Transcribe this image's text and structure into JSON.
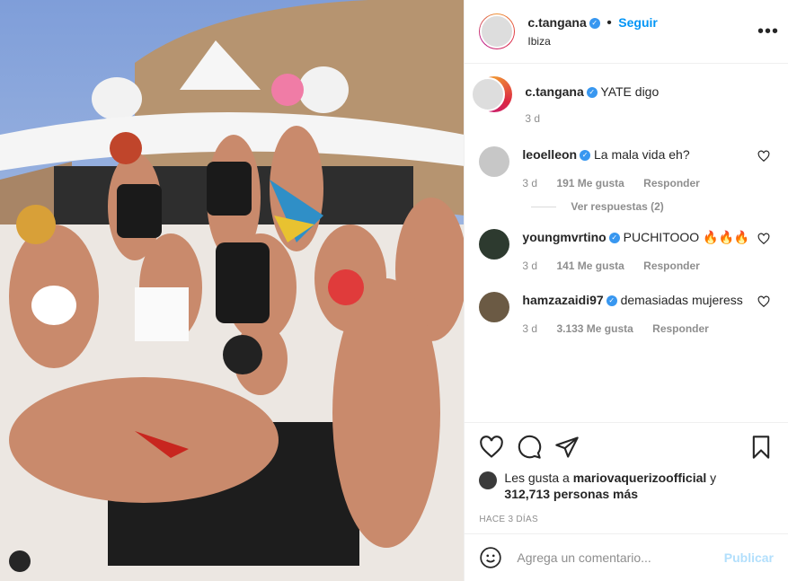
{
  "post": {
    "username": "c.tangana",
    "follow_label": "Seguir",
    "location": "Ibiza",
    "caption": "YATE digo",
    "caption_time": "3 d",
    "likes_prefix": "Les gusta a",
    "likes_user": "mariovaquerizoofficial",
    "likes_suffix": "y",
    "likes_count": "312,713 personas más",
    "posted": "HACE 3 DÍAS",
    "comment_placeholder": "Agrega un comentario...",
    "publish_label": "Publicar"
  },
  "comments": [
    {
      "user": "leoelleon",
      "text": "La mala vida eh?",
      "time": "3 d",
      "likes": "191 Me gusta",
      "reply": "Responder"
    },
    {
      "user": "youngmvrtino",
      "text": "PUCHITOOO 🔥🔥🔥",
      "time": "3 d",
      "likes": "141 Me gusta",
      "reply": "Responder"
    },
    {
      "user": "hamzazaidi97",
      "text": "demasiadas mujeress",
      "time": "3 d",
      "likes": "3.133 Me gusta",
      "reply": "Responder"
    }
  ],
  "view_replies": "Ver respuestas (2)",
  "colors": {
    "accent": "#0095f6",
    "muted": "#8e8e8e",
    "publish_disabled": "#b2dffc"
  }
}
